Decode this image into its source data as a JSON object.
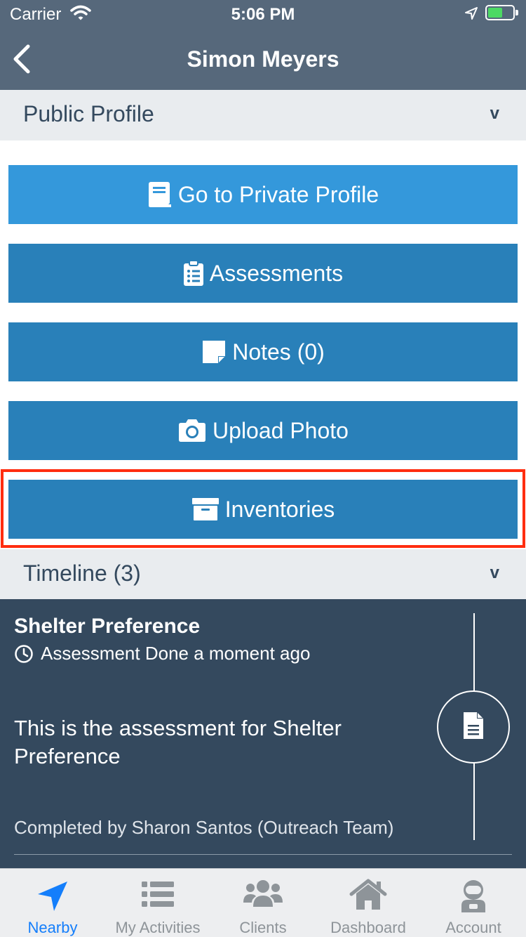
{
  "status_bar": {
    "carrier": "Carrier",
    "time": "5:06 PM"
  },
  "nav": {
    "title": "Simon Meyers"
  },
  "public_profile": {
    "title": "Public Profile",
    "chevron": "v"
  },
  "actions": [
    {
      "label": "Go to Private Profile",
      "icon": "book-icon"
    },
    {
      "label": "Assessments",
      "icon": "clipboard-icon"
    },
    {
      "label": "Notes (0)",
      "icon": "sticky-note-icon"
    },
    {
      "label": "Upload Photo",
      "icon": "camera-icon"
    },
    {
      "label": "Inventories",
      "icon": "archive-box-icon"
    }
  ],
  "timeline": {
    "title": "Timeline (3)",
    "chevron": "v",
    "entry": {
      "title": "Shelter Preference",
      "meta": "Assessment Done a moment ago",
      "body": "This is the assessment for Shelter Preference",
      "footer": "Completed by Sharon Santos (Outreach Team)"
    }
  },
  "tabs": [
    {
      "label": "Nearby",
      "icon": "location-arrow-icon",
      "active": true
    },
    {
      "label": "My Activities",
      "icon": "list-icon",
      "active": false
    },
    {
      "label": "Clients",
      "icon": "users-icon",
      "active": false
    },
    {
      "label": "Dashboard",
      "icon": "home-icon",
      "active": false
    },
    {
      "label": "Account",
      "icon": "astronaut-icon",
      "active": false
    }
  ],
  "colors": {
    "header": "#56687b",
    "button": "#2980b9",
    "button_light": "#3498db",
    "timeline_bg": "#34495e",
    "highlight": "#ff2d0f",
    "tab_active": "#147efb"
  }
}
